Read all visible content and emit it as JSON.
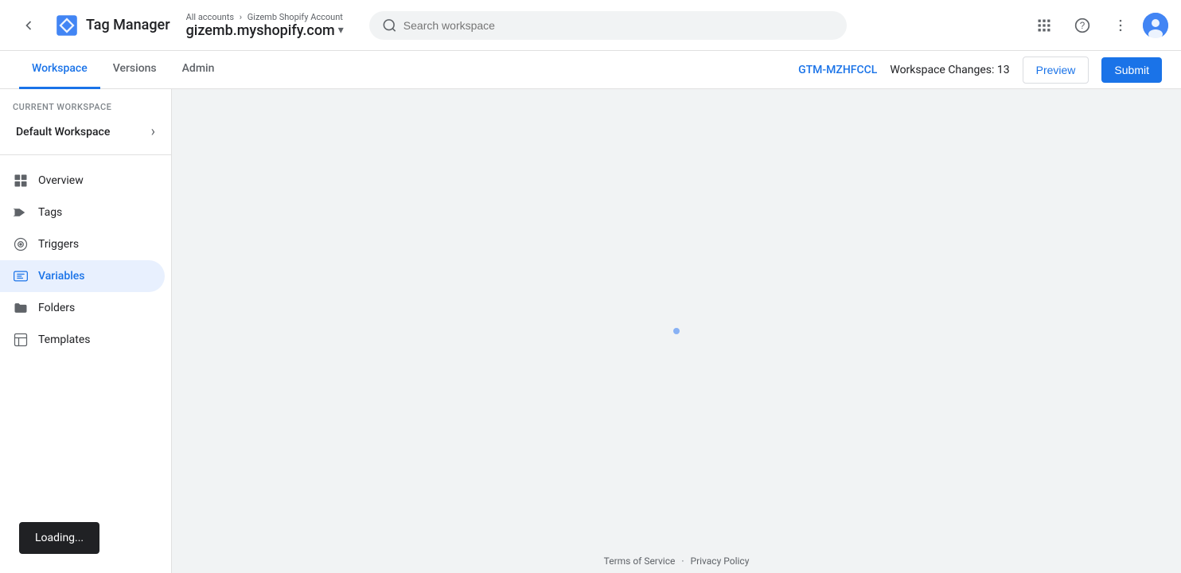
{
  "header": {
    "back_label": "←",
    "logo_text": "Tag Manager",
    "breadcrumb_top": "All accounts",
    "breadcrumb_sep": "›",
    "account_name": "Gizemb Shopify Account",
    "account_url": "gizemb.myshopify.com",
    "search_placeholder": "Search workspace",
    "apps_icon": "apps-icon",
    "help_icon": "help-icon",
    "more_icon": "more-vert-icon",
    "avatar_label": "U"
  },
  "subnav": {
    "tabs": [
      {
        "id": "workspace",
        "label": "Workspace",
        "active": true
      },
      {
        "id": "versions",
        "label": "Versions",
        "active": false
      },
      {
        "id": "admin",
        "label": "Admin",
        "active": false
      }
    ],
    "gtm_id": "GTM-MZHFCCL",
    "workspace_changes_label": "Workspace Changes:",
    "workspace_changes_count": "13",
    "preview_label": "Preview",
    "submit_label": "Submit"
  },
  "sidebar": {
    "current_workspace_label": "CURRENT WORKSPACE",
    "workspace_name": "Default Workspace",
    "nav_items": [
      {
        "id": "overview",
        "label": "Overview",
        "icon": "overview-icon"
      },
      {
        "id": "tags",
        "label": "Tags",
        "icon": "tags-icon"
      },
      {
        "id": "triggers",
        "label": "Triggers",
        "icon": "triggers-icon"
      },
      {
        "id": "variables",
        "label": "Variables",
        "icon": "variables-icon",
        "active": true
      },
      {
        "id": "folders",
        "label": "Folders",
        "icon": "folders-icon"
      },
      {
        "id": "templates",
        "label": "Templates",
        "icon": "templates-icon"
      }
    ]
  },
  "footer": {
    "terms_label": "Terms of Service",
    "separator": "·",
    "privacy_label": "Privacy Policy"
  },
  "loading": {
    "label": "Loading..."
  }
}
